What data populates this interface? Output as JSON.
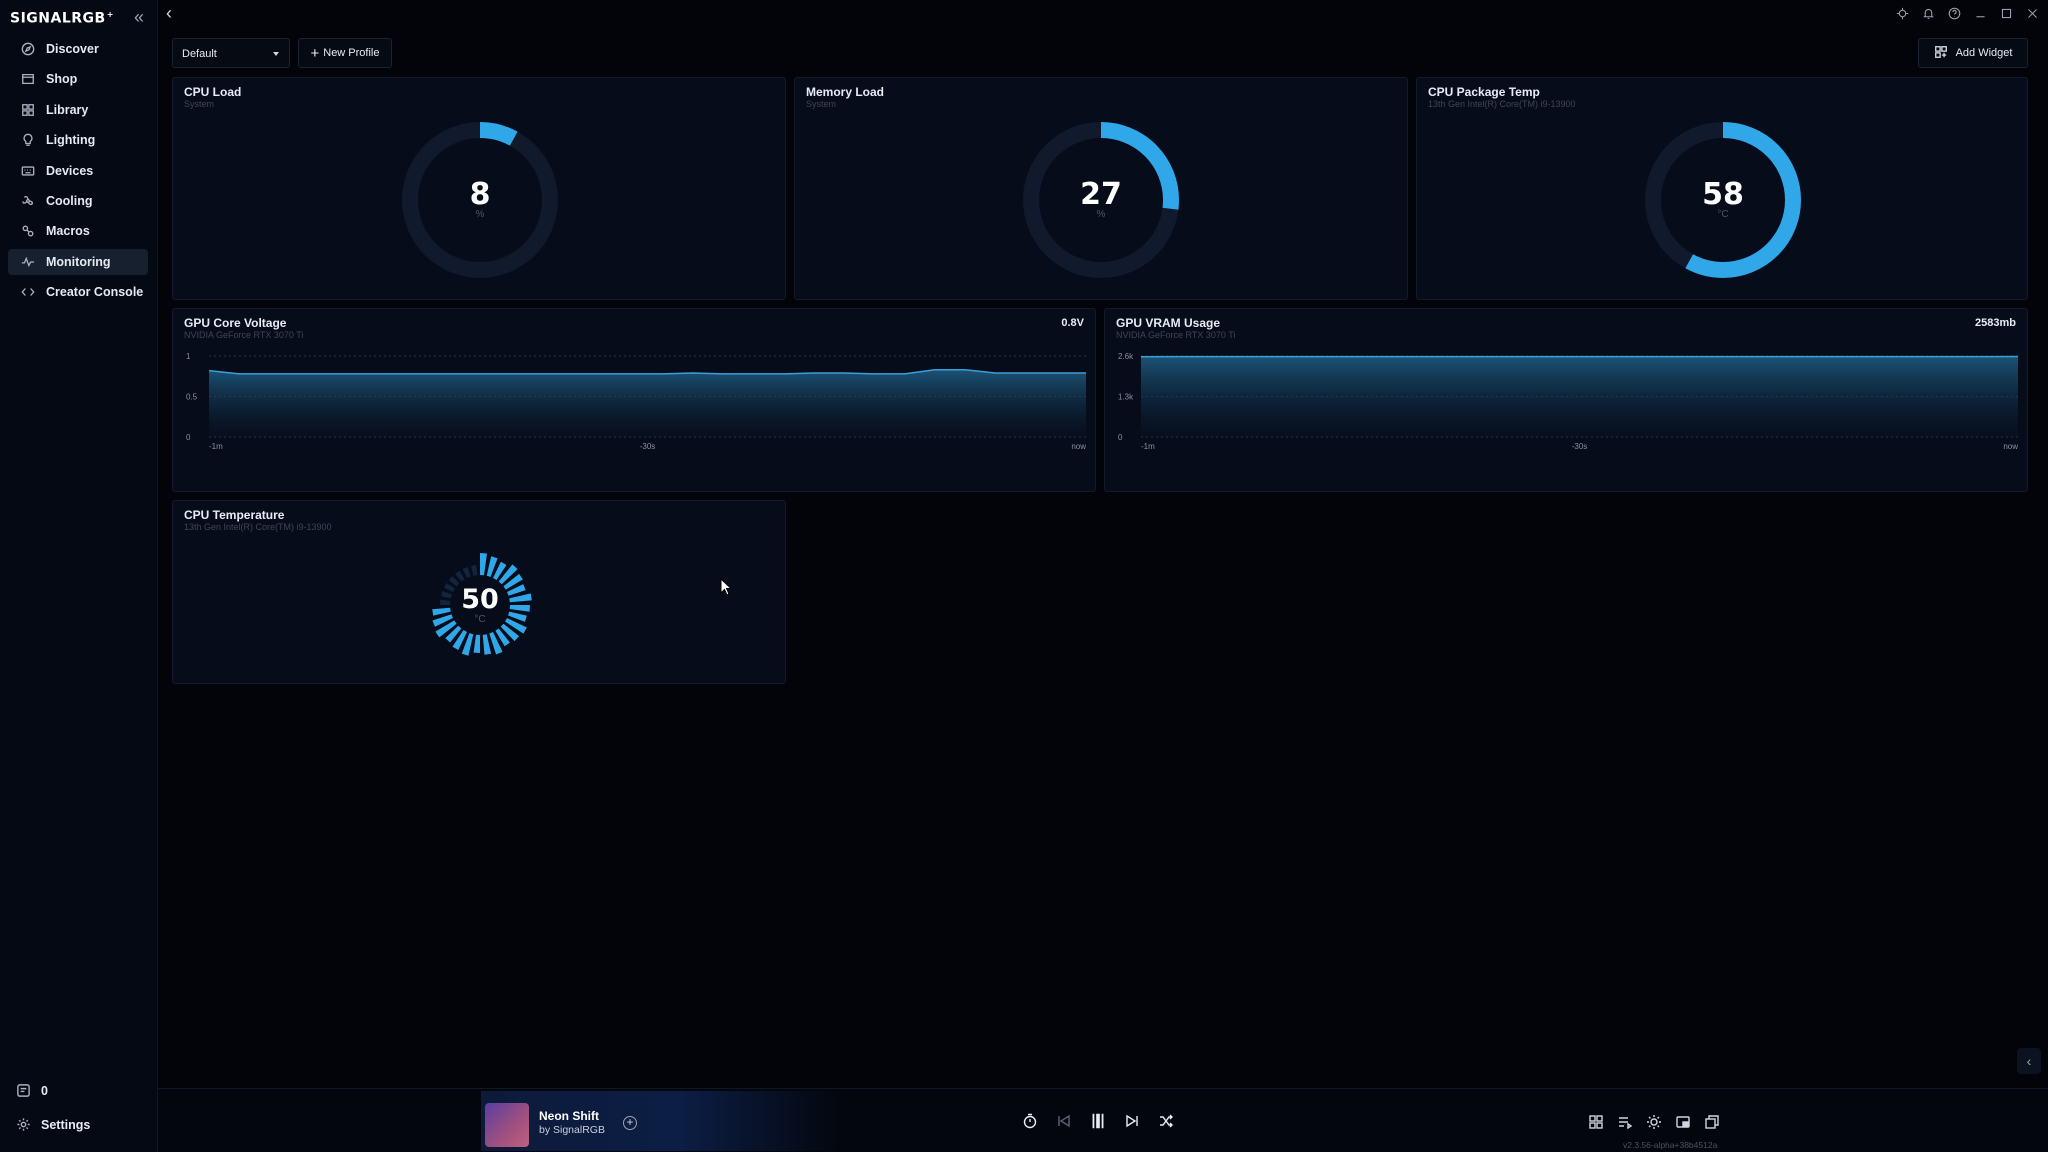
{
  "app": {
    "name": "SIGNALRGB",
    "logo_mark": "+"
  },
  "sidebar": {
    "items": [
      {
        "label": "Discover",
        "icon": "compass-icon"
      },
      {
        "label": "Shop",
        "icon": "shop-icon"
      },
      {
        "label": "Library",
        "icon": "grid-icon"
      },
      {
        "label": "Lighting",
        "icon": "bulb-icon"
      },
      {
        "label": "Devices",
        "icon": "keyboard-icon"
      },
      {
        "label": "Cooling",
        "icon": "fan-icon"
      },
      {
        "label": "Macros",
        "icon": "macro-icon"
      },
      {
        "label": "Monitoring",
        "icon": "pulse-icon",
        "active": true
      },
      {
        "label": "Creator Console",
        "icon": "code-icon"
      }
    ],
    "counter": "0",
    "settings_label": "Settings"
  },
  "toolbar": {
    "profile_value": "Default",
    "new_profile_label": "New Profile",
    "add_widget_label": "Add Widget"
  },
  "colors": {
    "accent": "#2fa7e8",
    "background": "#02040a",
    "panel": "#070c1a"
  },
  "widgets": {
    "cpu_load": {
      "title": "CPU Load",
      "subtitle": "System",
      "value": "8",
      "unit": "%",
      "fraction": 0.08
    },
    "memory_load": {
      "title": "Memory Load",
      "subtitle": "System",
      "value": "27",
      "unit": "%",
      "fraction": 0.27
    },
    "cpu_package_temp": {
      "title": "CPU Package Temp",
      "subtitle": "13th Gen Intel(R) Core(TM) i9-13900",
      "value": "58",
      "unit": "°C",
      "fraction": 0.58
    },
    "cpu_temperature": {
      "title": "CPU Temperature",
      "subtitle": "13th Gen Intel(R) Core(TM) i9-13900",
      "value": "50",
      "unit": "°C",
      "fraction": 0.5
    }
  },
  "chart_data": [
    {
      "type": "area",
      "title": "GPU Core Voltage",
      "subtitle": "NVIDIA GeForce RTX 3070 Ti",
      "current": "0.8V",
      "yticks": [
        "1",
        "0.5",
        "0"
      ],
      "xticks": [
        "-1m",
        "-30s",
        "now"
      ],
      "ylim": [
        0,
        1
      ],
      "series": [
        {
          "values": [
            0.82,
            0.78,
            0.78,
            0.78,
            0.78,
            0.78,
            0.78,
            0.78,
            0.78,
            0.78,
            0.78,
            0.78,
            0.78,
            0.78,
            0.78,
            0.78,
            0.79,
            0.78,
            0.78,
            0.78,
            0.79,
            0.79,
            0.78,
            0.78,
            0.83,
            0.83,
            0.79,
            0.79,
            0.79,
            0.79
          ]
        }
      ]
    },
    {
      "type": "area",
      "title": "GPU VRAM Usage",
      "subtitle": "NVIDIA GeForce RTX 3070 Ti",
      "current": "2583mb",
      "yticks": [
        "2.6k",
        "1.3k",
        "0"
      ],
      "xticks": [
        "-1m",
        "-30s",
        "now"
      ],
      "ylim": [
        0,
        2600
      ],
      "series": [
        {
          "values": [
            2575,
            2578,
            2578,
            2578,
            2578,
            2578,
            2578,
            2578,
            2578,
            2578,
            2578,
            2578,
            2578,
            2578,
            2578,
            2578,
            2578,
            2578,
            2578,
            2578,
            2578,
            2578,
            2578,
            2578,
            2578,
            2578,
            2578,
            2578,
            2580,
            2583
          ]
        }
      ]
    }
  ],
  "player": {
    "title": "Neon Shift",
    "by": "by SignalRGB"
  },
  "version": "v2.3.56-alpha+38b4512a"
}
